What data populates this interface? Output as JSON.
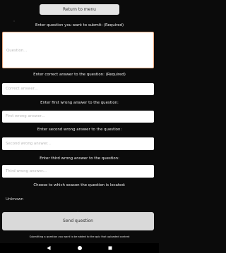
{
  "header": {
    "return_label": "Return to menu"
  },
  "question": {
    "label": "Enter question you want to submit: (Required)",
    "placeholder": "Question..."
  },
  "correct": {
    "label": "Enter correct answer to the question: (Required)",
    "placeholder": "Correct answer..."
  },
  "wrong1": {
    "label": "Enter first wrong answer to the question:",
    "placeholder": "First wrong answer..."
  },
  "wrong2": {
    "label": "Enter second wrong answer to the question:",
    "placeholder": "Second wrong answer..."
  },
  "wrong3": {
    "label": "Enter third wrong answer to the question:",
    "placeholder": "Third wrong answer..."
  },
  "season": {
    "label": "Choose to which season the question is located:",
    "selected": "Unknown"
  },
  "footer": {
    "send_label": "Send question",
    "note": "Submitting a question you want to be added to the quiz that uploaded content"
  },
  "navbar": {
    "back_icon": "back-triangle",
    "home_icon": "home-circle",
    "recents_icon": "recents-square"
  },
  "colors": {
    "background": "#0b0b0b",
    "button": "#e4e4e4",
    "focus_border": "#e8a97f"
  }
}
